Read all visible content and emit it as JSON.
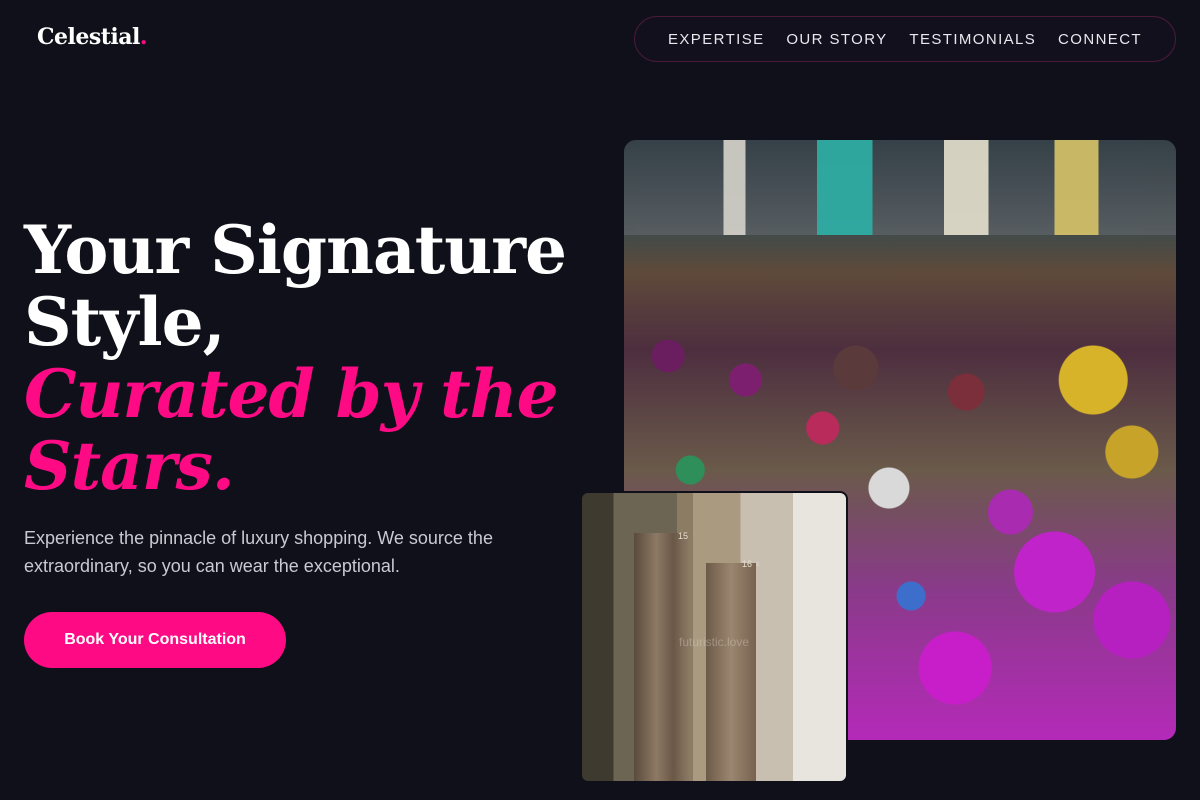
{
  "brand": {
    "name": "Celestial",
    "dot": ".",
    "accent_color": "#ff0a85"
  },
  "nav": {
    "items": [
      {
        "label": "EXPERTISE"
      },
      {
        "label": "OUR STORY"
      },
      {
        "label": "TESTIMONIALS"
      },
      {
        "label": "CONNECT"
      }
    ]
  },
  "hero": {
    "headline_line1": "Your Signature",
    "headline_line2": "Style,",
    "headline_line3": "Curated by the",
    "headline_line4": "Stars.",
    "subtext": "Experience the pinnacle of luxury shopping. We source the extraordinary, so you can wear the exceptional.",
    "cta_label": "Book Your Consultation"
  },
  "images": {
    "fitting_room": {
      "label_15": "15",
      "label_16": "16 ♀",
      "watermark": "futuristic.love"
    }
  },
  "colors": {
    "background": "#10101a",
    "accent": "#ff0a85",
    "text": "#ffffff",
    "muted_text": "#c9c9d3"
  }
}
